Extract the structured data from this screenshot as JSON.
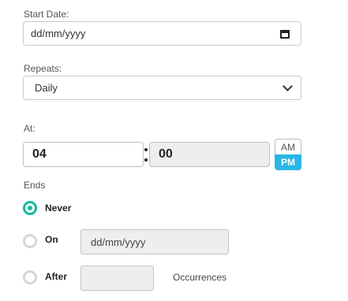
{
  "start_date": {
    "label": "Start Date:",
    "placeholder": "dd/mm/yyyy",
    "icon": "calendar-icon"
  },
  "repeats": {
    "label": "Repeats:",
    "selected": "Daily",
    "icon": "chevron-down-icon"
  },
  "at": {
    "label": "At:",
    "hour": "04",
    "minute": "00",
    "am_label": "AM",
    "pm_label": "PM",
    "selected_period": "PM",
    "accent_color": "#29b6e6"
  },
  "ends": {
    "label": "Ends",
    "accent_color": "#19b5a0",
    "options": [
      {
        "label": "Never",
        "selected": true
      },
      {
        "label": "On",
        "selected": false,
        "placeholder": "dd/mm/yyyy"
      },
      {
        "label": "After",
        "selected": false,
        "suffix": "Occurrences"
      }
    ]
  }
}
